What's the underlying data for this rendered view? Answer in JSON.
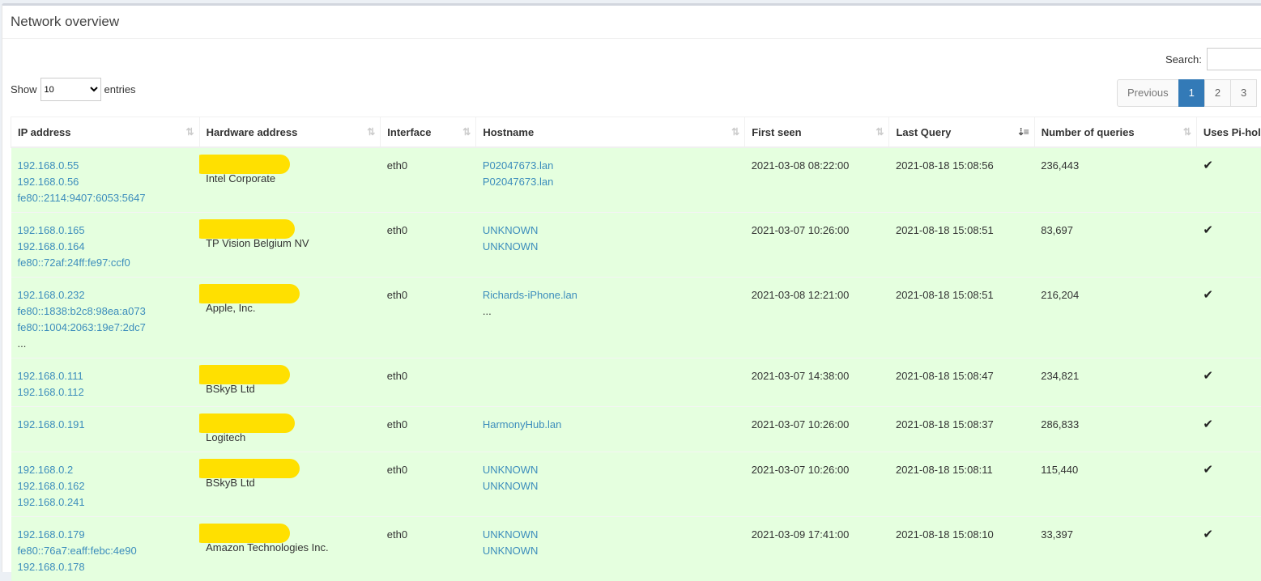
{
  "title": "Network overview",
  "search": {
    "label": "Search:",
    "value": ""
  },
  "length": {
    "show": "Show",
    "entries": "entries",
    "selected": "10"
  },
  "pagination": {
    "previous": "Previous",
    "pages": [
      "1",
      "2",
      "3"
    ],
    "active": "1"
  },
  "columns": [
    {
      "label": "IP address",
      "sort": "sortable"
    },
    {
      "label": "Hardware address",
      "sort": "sortable"
    },
    {
      "label": "Interface",
      "sort": "sortable"
    },
    {
      "label": "Hostname",
      "sort": "sortable"
    },
    {
      "label": "First seen",
      "sort": "sortable"
    },
    {
      "label": "Last Query",
      "sort": "descending"
    },
    {
      "label": "Number of queries",
      "sort": "sortable"
    },
    {
      "label": "Uses Pi-hole",
      "sort": "sortable"
    }
  ],
  "rows": [
    {
      "ips": [
        "192.168.0.55",
        "192.168.0.56",
        "fe80::2114:9407:6053:5647"
      ],
      "vendor": "Intel Corporate",
      "interface": "eth0",
      "hostnames": [
        "P02047673.lan",
        "P02047673.lan"
      ],
      "first_seen": "2021-03-08 08:22:00",
      "last_query": "2021-08-18 15:08:56",
      "queries": "236,443",
      "uses_pihole": "✔"
    },
    {
      "ips": [
        "192.168.0.165",
        "192.168.0.164",
        "fe80::72af:24ff:fe97:ccf0"
      ],
      "vendor": "TP Vision Belgium NV",
      "interface": "eth0",
      "hostnames": [
        "UNKNOWN",
        "UNKNOWN"
      ],
      "first_seen": "2021-03-07 10:26:00",
      "last_query": "2021-08-18 15:08:51",
      "queries": "83,697",
      "uses_pihole": "✔"
    },
    {
      "ips": [
        "192.168.0.232",
        "fe80::1838:b2c8:98ea:a073",
        "fe80::1004:2063:19e7:2dc7"
      ],
      "ips_more": "...",
      "vendor": "Apple, Inc.",
      "interface": "eth0",
      "hostnames": [
        "Richards-iPhone.lan"
      ],
      "hostnames_more": "...",
      "first_seen": "2021-03-08 12:21:00",
      "last_query": "2021-08-18 15:08:51",
      "queries": "216,204",
      "uses_pihole": "✔"
    },
    {
      "ips": [
        "192.168.0.111",
        "192.168.0.112"
      ],
      "vendor": "BSkyB Ltd",
      "interface": "eth0",
      "hostnames": [],
      "first_seen": "2021-03-07 14:38:00",
      "last_query": "2021-08-18 15:08:47",
      "queries": "234,821",
      "uses_pihole": "✔"
    },
    {
      "ips": [
        "192.168.0.191"
      ],
      "vendor": "Logitech",
      "interface": "eth0",
      "hostnames": [
        "HarmonyHub.lan"
      ],
      "first_seen": "2021-03-07 10:26:00",
      "last_query": "2021-08-18 15:08:37",
      "queries": "286,833",
      "uses_pihole": "✔"
    },
    {
      "ips": [
        "192.168.0.2",
        "192.168.0.162",
        "192.168.0.241"
      ],
      "vendor": "BSkyB Ltd",
      "interface": "eth0",
      "hostnames": [
        "UNKNOWN",
        "UNKNOWN"
      ],
      "first_seen": "2021-03-07 10:26:00",
      "last_query": "2021-08-18 15:08:11",
      "queries": "115,440",
      "uses_pihole": "✔"
    },
    {
      "ips": [
        "192.168.0.179",
        "fe80::76a7:eaff:febc:4e90",
        "192.168.0.178"
      ],
      "vendor": "Amazon Technologies Inc.",
      "interface": "eth0",
      "hostnames": [
        "UNKNOWN",
        "UNKNOWN"
      ],
      "first_seen": "2021-03-09 17:41:00",
      "last_query": "2021-08-18 15:08:10",
      "queries": "33,397",
      "uses_pihole": "✔"
    }
  ],
  "colors": {
    "row_bg": "#e5ffdf",
    "link": "#3c8dbc",
    "active_page": "#337ab7",
    "redaction": "#ffe000"
  },
  "icons": {
    "sort": "sort-arrows-icon",
    "sort_desc": "sort-descending-icon",
    "check": "check-icon"
  }
}
